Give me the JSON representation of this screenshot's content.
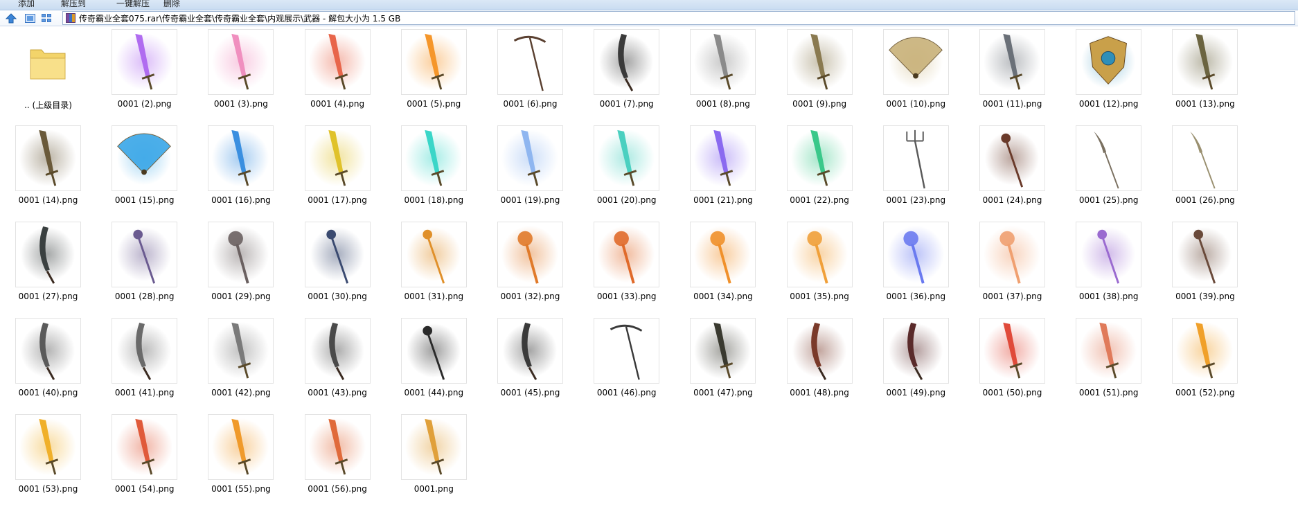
{
  "toolbar": {
    "buttons": [
      "添加",
      "解压到",
      "一键解压",
      "删除"
    ]
  },
  "address": {
    "path": "传奇霸业全套075.rar\\传奇霸业全套\\传奇霸业全套\\内观展示\\武器 - 解包大小为 1.5 GB"
  },
  "icons": {
    "nav_up": "up-arrow-icon",
    "view_thumbnails": "thumbnail-view-icon",
    "view_grid": "grid-view-icon",
    "archive": "rar-archive-icon",
    "folder": "folder-icon"
  },
  "files": [
    {
      "name": ".. (上级目录)",
      "kind": "folder"
    },
    {
      "name": "0001 (2).png",
      "kind": "sword",
      "color": "#b06cf0"
    },
    {
      "name": "0001 (3).png",
      "kind": "sword",
      "color": "#f08fbf"
    },
    {
      "name": "0001 (4).png",
      "kind": "sword",
      "color": "#e8654a"
    },
    {
      "name": "0001 (5).png",
      "kind": "sword",
      "color": "#f5962a"
    },
    {
      "name": "0001 (6).png",
      "kind": "pick",
      "color": "#5a4030"
    },
    {
      "name": "0001 (7).png",
      "kind": "scimitar",
      "color": "#3a3a3a"
    },
    {
      "name": "0001 (8).png",
      "kind": "sword",
      "color": "#8a8a8a"
    },
    {
      "name": "0001 (9).png",
      "kind": "sword",
      "color": "#8a7a50"
    },
    {
      "name": "0001 (10).png",
      "kind": "fan",
      "color": "#c9b27a"
    },
    {
      "name": "0001 (11).png",
      "kind": "sword",
      "color": "#6a7078"
    },
    {
      "name": "0001 (12).png",
      "kind": "shield",
      "color": "#2f8fb8"
    },
    {
      "name": "0001 (13).png",
      "kind": "sword",
      "color": "#6b6440"
    },
    {
      "name": "0001 (14).png",
      "kind": "sword",
      "color": "#6a5a3a"
    },
    {
      "name": "0001 (15).png",
      "kind": "fan",
      "color": "#3aa7e8"
    },
    {
      "name": "0001 (16).png",
      "kind": "sword",
      "color": "#3a8fe0"
    },
    {
      "name": "0001 (17).png",
      "kind": "sword",
      "color": "#e0c22a"
    },
    {
      "name": "0001 (18).png",
      "kind": "sword",
      "color": "#3ad6c8"
    },
    {
      "name": "0001 (19).png",
      "kind": "sword",
      "color": "#8fb6f0"
    },
    {
      "name": "0001 (20).png",
      "kind": "sword",
      "color": "#4ad0c0"
    },
    {
      "name": "0001 (21).png",
      "kind": "sword",
      "color": "#8a6af0"
    },
    {
      "name": "0001 (22).png",
      "kind": "sword",
      "color": "#3ac88a"
    },
    {
      "name": "0001 (23).png",
      "kind": "trident",
      "color": "#5a5a5a"
    },
    {
      "name": "0001 (24).png",
      "kind": "staff",
      "color": "#6a3a2a"
    },
    {
      "name": "0001 (25).png",
      "kind": "glaive",
      "color": "#7a7060"
    },
    {
      "name": "0001 (26).png",
      "kind": "glaive",
      "color": "#9a9070"
    },
    {
      "name": "0001 (27).png",
      "kind": "scimitar",
      "color": "#3a4040"
    },
    {
      "name": "0001 (28).png",
      "kind": "staff",
      "color": "#6a5a90"
    },
    {
      "name": "0001 (29).png",
      "kind": "mace",
      "color": "#6a6060"
    },
    {
      "name": "0001 (30).png",
      "kind": "staff",
      "color": "#3a4a70"
    },
    {
      "name": "0001 (31).png",
      "kind": "staff",
      "color": "#e0902a"
    },
    {
      "name": "0001 (32).png",
      "kind": "mace",
      "color": "#e07a2a"
    },
    {
      "name": "0001 (33).png",
      "kind": "mace",
      "color": "#e06a2a"
    },
    {
      "name": "0001 (34).png",
      "kind": "mace",
      "color": "#f0902a"
    },
    {
      "name": "0001 (35).png",
      "kind": "mace",
      "color": "#f0a03a"
    },
    {
      "name": "0001 (36).png",
      "kind": "mace",
      "color": "#6a7af0"
    },
    {
      "name": "0001 (37).png",
      "kind": "mace",
      "color": "#f0a070"
    },
    {
      "name": "0001 (38).png",
      "kind": "staff",
      "color": "#9a6ad0"
    },
    {
      "name": "0001 (39).png",
      "kind": "staff",
      "color": "#6a4a3a"
    },
    {
      "name": "0001 (40).png",
      "kind": "scimitar",
      "color": "#5a5a5a"
    },
    {
      "name": "0001 (41).png",
      "kind": "scimitar",
      "color": "#6a6a6a"
    },
    {
      "name": "0001 (42).png",
      "kind": "sword",
      "color": "#7a7a7a"
    },
    {
      "name": "0001 (43).png",
      "kind": "scimitar",
      "color": "#4a4a4a"
    },
    {
      "name": "0001 (44).png",
      "kind": "staff",
      "color": "#2a2a2a"
    },
    {
      "name": "0001 (45).png",
      "kind": "scimitar",
      "color": "#3a3a3a"
    },
    {
      "name": "0001 (46).png",
      "kind": "pick",
      "color": "#3a3a3a"
    },
    {
      "name": "0001 (47).png",
      "kind": "sword",
      "color": "#3a3a30"
    },
    {
      "name": "0001 (48).png",
      "kind": "scimitar",
      "color": "#7a3a2a"
    },
    {
      "name": "0001 (49).png",
      "kind": "scimitar",
      "color": "#5a2a2a"
    },
    {
      "name": "0001 (50).png",
      "kind": "sword",
      "color": "#e04a3a"
    },
    {
      "name": "0001 (51).png",
      "kind": "sword",
      "color": "#e07a5a"
    },
    {
      "name": "0001 (52).png",
      "kind": "sword",
      "color": "#f0a02a"
    },
    {
      "name": "0001 (53).png",
      "kind": "sword",
      "color": "#f0b02a"
    },
    {
      "name": "0001 (54).png",
      "kind": "sword",
      "color": "#e05a3a"
    },
    {
      "name": "0001 (55).png",
      "kind": "sword",
      "color": "#f09a2a"
    },
    {
      "name": "0001 (56).png",
      "kind": "sword",
      "color": "#e06a3a"
    },
    {
      "name": "0001.png",
      "kind": "sword",
      "color": "#e0a03a"
    }
  ]
}
